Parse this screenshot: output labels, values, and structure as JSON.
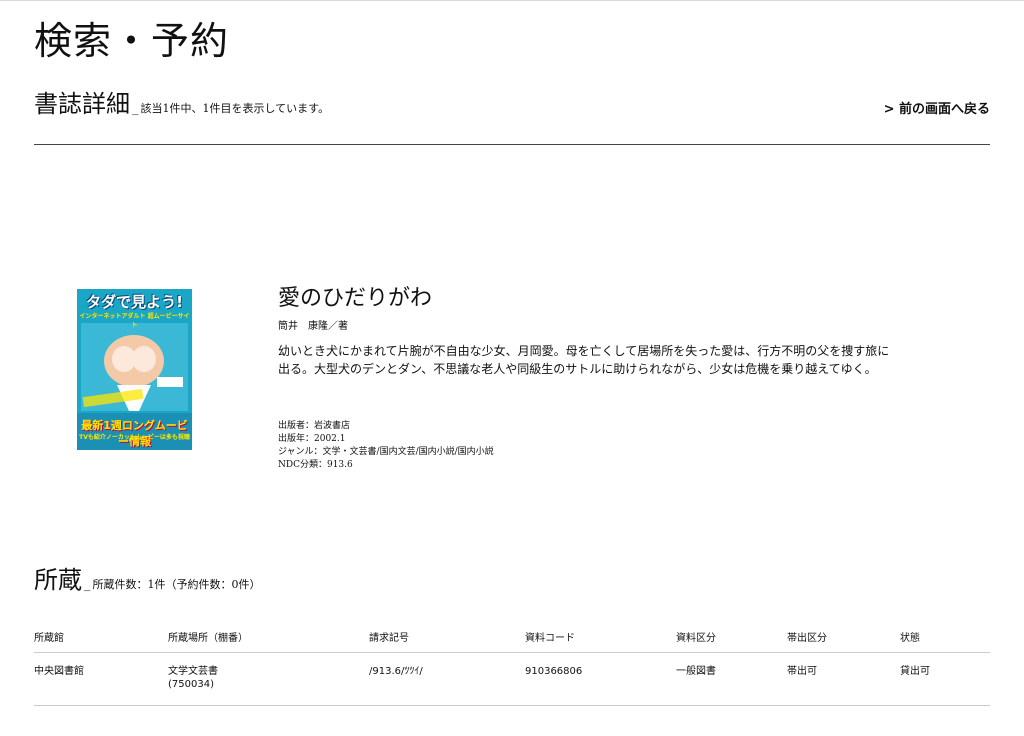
{
  "page": {
    "title": "検索・予約"
  },
  "detail": {
    "heading": "書誌詳細",
    "underscore": "_",
    "count_note": "該当1件中、1件目を表示しています。",
    "back_link": "> 前の画面へ戻る"
  },
  "book": {
    "cover": {
      "title": "タダで見よう!",
      "subtitle": "インターネットアダルト 超ムービーサイト",
      "bottom": "最新1週ロングムービー情報",
      "bottom2": "TVも紹介ノーカットムービーは多も視聴"
    },
    "title": "愛のひだりがわ",
    "author": "筒井　康隆／著",
    "description": "幼いとき犬にかまれて片腕が不自由な少女、月岡愛。母を亡くして居場所を失った愛は、行方不明の父を捜す旅に出る。大型犬のデンとダン、不思議な老人や同級生のサトルに助けられながら、少女は危機を乗り越えてゆく。",
    "publisher": "出版者：岩波書店",
    "year": "出版年：2002.1",
    "genre": "ジャンル：文学・文芸書/国内文芸/国内小説/国内小説",
    "ndc": "NDC分類：913.6"
  },
  "holdings": {
    "heading": "所蔵",
    "underscore": "_",
    "count_note": "所蔵件数：1件（予約件数：0件）",
    "columns": [
      "所蔵館",
      "所蔵場所（棚番）",
      "請求記号",
      "資料コード",
      "資料区分",
      "帯出区分",
      "状態"
    ],
    "rows": [
      {
        "library": "中央図書館",
        "location": "文学文芸書",
        "shelf": "(750034)",
        "call_number": "/913.6/ﾂﾂｲ/",
        "code": "910366806",
        "category": "一般図書",
        "loan_type": "帯出可",
        "status": "貸出可"
      }
    ]
  },
  "colors": {
    "cover_bg": "#1aa6c6",
    "rule": "#444444",
    "table_border": "#cccccc"
  }
}
